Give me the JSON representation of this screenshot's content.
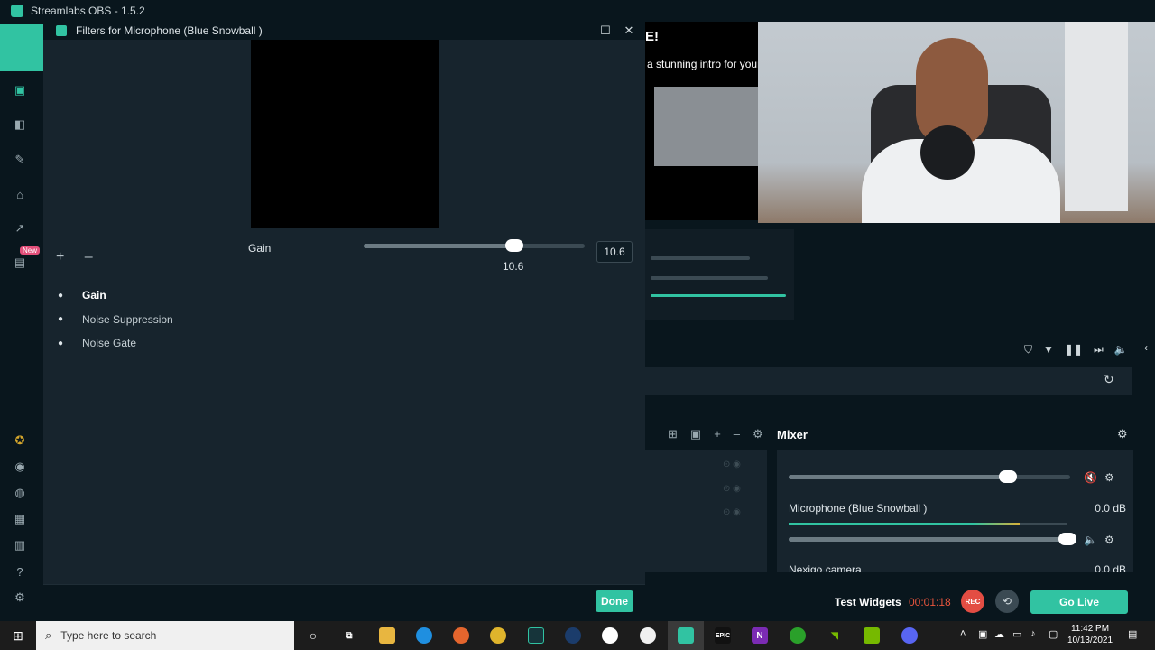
{
  "app": {
    "title": "Streamlabs OBS - 1.5.2"
  },
  "dialog": {
    "title": "Filters for Microphone (Blue Snowball )",
    "toolbar": {
      "add": "+",
      "remove": "–"
    },
    "filters": [
      {
        "label": "Gain",
        "selected": true
      },
      {
        "label": "Noise Suppression",
        "selected": false
      },
      {
        "label": "Noise Gate",
        "selected": false
      }
    ],
    "gain": {
      "label": "Gain",
      "value": "10.6",
      "box_value": "10.6",
      "slider_fraction": 0.68
    },
    "done_label": "Done"
  },
  "rail": {
    "new_badge": "New"
  },
  "preview": {
    "headline": "E!",
    "subline": "a stunning intro for your"
  },
  "mixer": {
    "title": "Mixer",
    "channels": [
      {
        "name": "",
        "db": "",
        "fraction": 0.78
      },
      {
        "name": "Microphone (Blue Snowball )",
        "db": "0.0 dB",
        "fraction": 0.99,
        "meter_fraction": 0.83
      },
      {
        "name": "Nexigo camera",
        "db": "0.0 dB"
      }
    ]
  },
  "status": {
    "test_widgets": "Test Widgets",
    "rec_time": "00:01:18",
    "rec_label": "REC",
    "go_live": "Go Live"
  },
  "taskbar": {
    "search_placeholder": "Type here to search",
    "time": "11:42 PM",
    "date": "10/13/2021"
  },
  "colors": {
    "accent": "#31c3a2",
    "rec": "#e34d43",
    "bg": "#09161d",
    "panel": "#17242d"
  }
}
